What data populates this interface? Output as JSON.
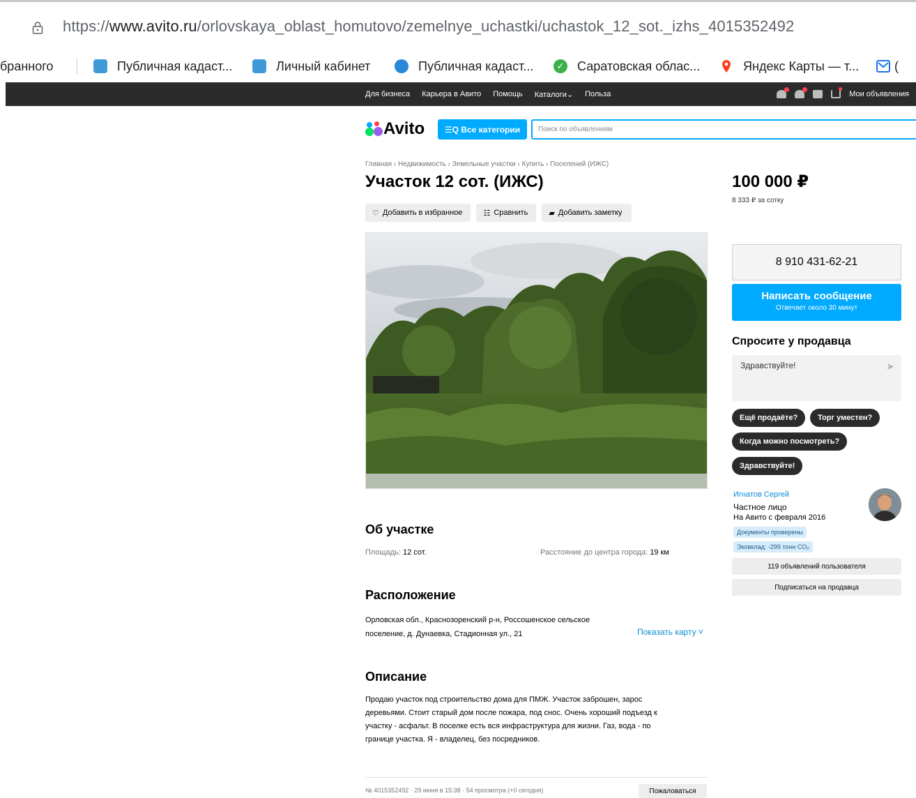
{
  "browser": {
    "url_prefix": "https://",
    "url_host": "www.avito.ru",
    "url_path": "/orlovskaya_oblast_homutovo/zemelnye_uchastki/uchastok_12_sot._izhs_4015352492"
  },
  "bookmarks": [
    {
      "label": "бранного",
      "icon": "none"
    },
    {
      "label": "Публичная кадаст...",
      "icon": "rosreestr-icon",
      "color": "#3f9bd8"
    },
    {
      "label": "Личный кабинет",
      "icon": "rosreestr-icon",
      "color": "#3f9bd8"
    },
    {
      "label": "Публичная кадаст...",
      "icon": "house-icon",
      "color": "#2a88d8"
    },
    {
      "label": "Саратовская облас...",
      "icon": "check-icon",
      "color": "#3bb04a"
    },
    {
      "label": "Яндекс Карты — т...",
      "icon": "map-pin-icon",
      "color": "#fc3f1d"
    },
    {
      "label": "(",
      "icon": "mail-icon",
      "color": "#1a73e8"
    }
  ],
  "topnav": {
    "links": [
      "Для бизнеса",
      "Карьера в Авито",
      "Помощь",
      "Каталоги⌄",
      "Польза"
    ],
    "my_ads": "Мои объявления"
  },
  "header": {
    "logo": "Avito",
    "categories_button": "☰Q Все категории",
    "search_placeholder": "Поиск по объявлениям"
  },
  "breadcrumb": "Главная › Недвижимость › Земельные участки › Купить › Поселений (ИЖС)",
  "title": "Участок 12 сот. (ИЖС)",
  "actions": {
    "favorite": "Добавить в избранное",
    "compare": "Сравнить",
    "note": "Добавить заметку"
  },
  "price": {
    "value": "100 000 ₽",
    "per_unit": "8 333 ₽ за сотку"
  },
  "contact": {
    "phone": "8 910 431-62-21",
    "message_button": "Написать сообщение",
    "message_sub": "Отвечает около 30 минут"
  },
  "ask": {
    "title": "Спросите у продавца",
    "draft": "Здравствуйте!",
    "chips": [
      "Ещё продаёте?",
      "Торг уместен?",
      "Когда можно посмотреть?",
      "Здравствуйте!"
    ]
  },
  "seller": {
    "name": "Игнатов Сергей",
    "type": "Частное лицо",
    "since": "На Авито с февраля 2016",
    "tags": [
      "Документы проверены",
      "Эковклад: -299 тонн CO₂"
    ],
    "ads_button": "119 объявлений пользователя",
    "subscribe_button": "Подписаться на продавца"
  },
  "about": {
    "title": "Об участке",
    "area_label": "Площадь:",
    "area_value": "12 сот.",
    "distance_label": "Расстояние до центра города:",
    "distance_value": "19 км"
  },
  "location": {
    "title": "Расположение",
    "address_line1": "Орловская обл., Краснозоренский р-н, Россошенское сельское",
    "address_line2": "поселение, д. Дунаевка, Стадионная ул., 21",
    "show_map": "Показать карту ˅"
  },
  "description": {
    "title": "Описание",
    "lines": [
      "Продаю участок под строительство дома для ПМЖ. Участок заброшен, зарос",
      "деревьями. Стоит старый дом после пожара, под снос. Очень хороший подъезд к",
      "участку - асфальт. В поселке есть вся инфраструктура для жизни. Газ, вода - по",
      "границе участка. Я - владелец, без посредников."
    ]
  },
  "footer": {
    "meta": "№ 4015352492 · 29 июня в 15:38 · 54 просмотра (+0 сегодня)",
    "report": "Пожаловаться"
  },
  "colors": {
    "accent": "#00aaff",
    "dark_nav": "#2b2b2b",
    "link": "#0a8bd6"
  }
}
